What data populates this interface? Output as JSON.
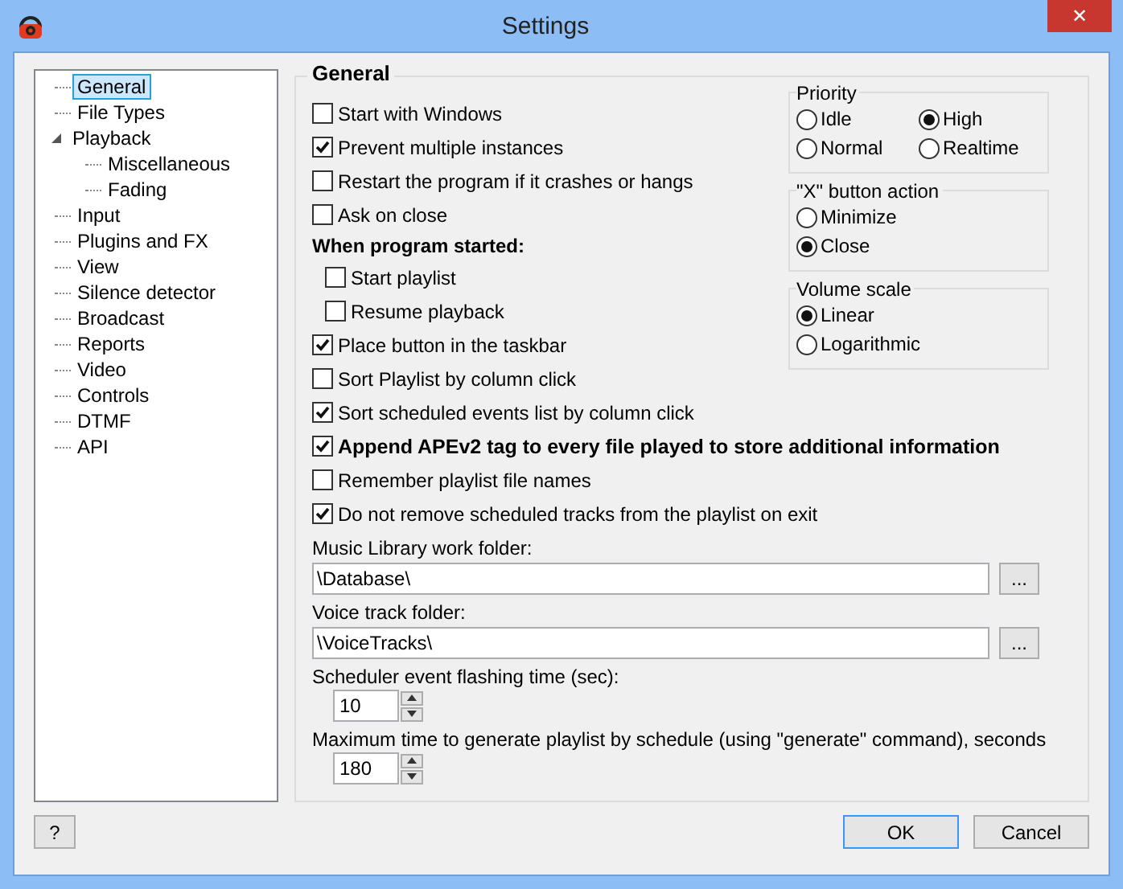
{
  "window": {
    "title": "Settings",
    "close": "✕"
  },
  "tree": [
    {
      "label": "General",
      "selected": true
    },
    {
      "label": "File Types",
      "selected": false
    },
    {
      "label": "Playback",
      "selected": false,
      "expanded": true,
      "children": [
        {
          "label": "Miscellaneous",
          "selected": false
        },
        {
          "label": "Fading",
          "selected": false
        }
      ]
    },
    {
      "label": "Input",
      "selected": false
    },
    {
      "label": "Plugins and FX",
      "selected": false
    },
    {
      "label": "View",
      "selected": false
    },
    {
      "label": "Silence detector",
      "selected": false
    },
    {
      "label": "Broadcast",
      "selected": false
    },
    {
      "label": "Reports",
      "selected": false
    },
    {
      "label": "Video",
      "selected": false
    },
    {
      "label": "Controls",
      "selected": false
    },
    {
      "label": "DTMF",
      "selected": false
    },
    {
      "label": "API",
      "selected": false
    }
  ],
  "group_title": "General",
  "options_top": [
    {
      "kind": "checkbox",
      "label": "Start with Windows",
      "checked": false
    },
    {
      "kind": "checkbox",
      "label": "Prevent multiple instances",
      "checked": true
    },
    {
      "kind": "checkbox",
      "label": "Restart the program if it crashes or hangs",
      "checked": false
    },
    {
      "kind": "checkbox",
      "label": "Ask on close",
      "checked": false
    },
    {
      "kind": "heading",
      "label": "When program started:"
    },
    {
      "kind": "subcheckbox",
      "label": "Start playlist",
      "checked": false
    },
    {
      "kind": "subcheckbox",
      "label": "Resume playback",
      "checked": false
    },
    {
      "kind": "checkbox",
      "label": "Place button in the taskbar",
      "checked": true
    },
    {
      "kind": "checkbox",
      "label": "Sort Playlist by column click",
      "checked": false
    },
    {
      "kind": "checkbox",
      "label": "Sort scheduled events list by column click",
      "checked": true
    }
  ],
  "options_bottom": [
    {
      "kind": "boldcheckbox",
      "label": "Append APEv2 tag to every file played to store additional information",
      "checked": true
    },
    {
      "kind": "checkbox",
      "label": "Remember playlist file names",
      "checked": false
    },
    {
      "kind": "checkbox",
      "label": "Do not remove scheduled tracks from the playlist on exit",
      "checked": true
    }
  ],
  "radio_groups": [
    {
      "title": "Priority",
      "kind": "grid",
      "options": [
        {
          "label": "Idle",
          "selected": false
        },
        {
          "label": "High",
          "selected": true
        },
        {
          "label": "Normal",
          "selected": false
        },
        {
          "label": "Realtime",
          "selected": false
        }
      ]
    },
    {
      "title": "\"X\" button action",
      "kind": "list",
      "options": [
        {
          "label": "Minimize",
          "selected": false
        },
        {
          "label": "Close",
          "selected": true
        }
      ]
    },
    {
      "title": "Volume scale",
      "kind": "list",
      "options": [
        {
          "label": "Linear",
          "selected": true
        },
        {
          "label": "Logarithmic",
          "selected": false
        }
      ]
    }
  ],
  "folders": [
    {
      "label": "Music Library work folder:",
      "value": "\\Database\\",
      "browse": "..."
    },
    {
      "label": "Voice track folder:",
      "value": "\\VoiceTracks\\",
      "browse": "..."
    }
  ],
  "spinners": [
    {
      "label": "Scheduler event flashing time (sec):",
      "value": "10"
    },
    {
      "label": "Maximum time to generate playlist by schedule (using \"generate\" command), seconds",
      "value": "180"
    }
  ],
  "buttons": {
    "help": "?",
    "ok": "OK",
    "cancel": "Cancel"
  }
}
